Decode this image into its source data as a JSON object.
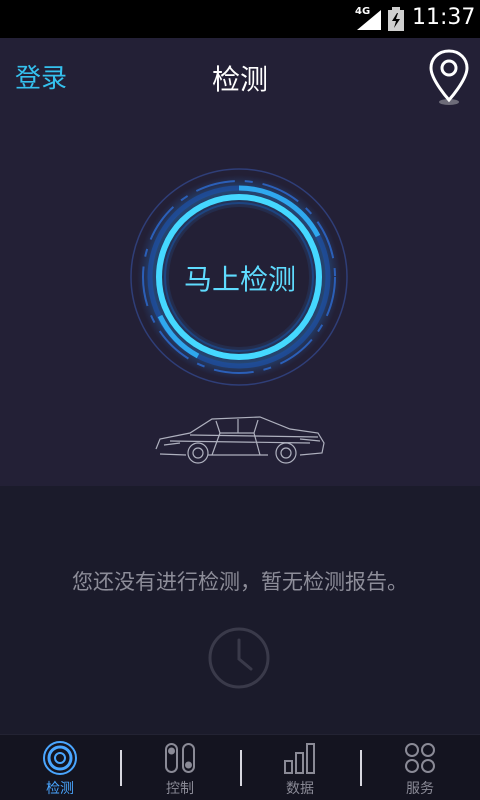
{
  "status_bar": {
    "network": "4G",
    "time": "11:37"
  },
  "header": {
    "login_label": "登录",
    "title": "检测",
    "location_icon": "location-pin-icon"
  },
  "detect": {
    "button_label": "马上检测",
    "car_icon": "car-wireframe-image"
  },
  "empty_state": {
    "message": "您还没有进行检测，暂无检测报告。",
    "icon": "clock-icon"
  },
  "bottom_nav": {
    "items": [
      {
        "label": "检测",
        "icon": "detect-icon",
        "active": true
      },
      {
        "label": "控制",
        "icon": "control-icon",
        "active": false
      },
      {
        "label": "数据",
        "icon": "data-bars-icon",
        "active": false
      },
      {
        "label": "服务",
        "icon": "service-dots-icon",
        "active": false
      }
    ]
  },
  "colors": {
    "accent": "#35c1ee",
    "ring": "#3fd6ff",
    "active_nav": "#4aa6ff",
    "panel_bg": "#232036",
    "page_bg": "#1b1b2b"
  }
}
